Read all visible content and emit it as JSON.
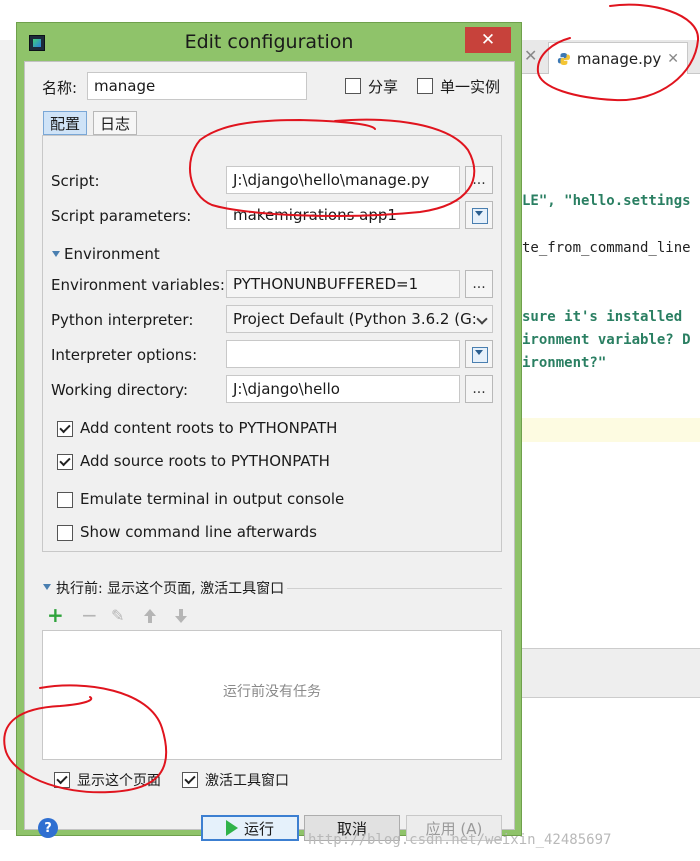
{
  "dialog": {
    "title": "Edit configuration",
    "close_glyph": "✕"
  },
  "header": {
    "name_label": "名称:",
    "name_value": "manage",
    "share_label": "分享",
    "single_instance_label": "单一实例"
  },
  "tabs": [
    {
      "label": "配置",
      "active": true
    },
    {
      "label": "日志",
      "active": false
    }
  ],
  "form": {
    "script_label": "Script:",
    "script_value": "J:\\django\\hello\\manage.py",
    "script_params_label": "Script parameters:",
    "script_params_value": "makemigrations app1",
    "environment_label": "Environment",
    "env_vars_label": "Environment variables:",
    "env_vars_value": "PYTHONUNBUFFERED=1",
    "python_interpreter_label": "Python interpreter:",
    "python_interpreter_value": "Project Default (Python 3.6.2 (G:",
    "interpreter_options_label": "Interpreter options:",
    "interpreter_options_value": "",
    "working_dir_label": "Working directory:",
    "working_dir_value": "J:\\django\\hello",
    "browse_glyph": "...",
    "checkboxes": [
      {
        "label": "Add content roots to PYTHONPATH",
        "checked": true
      },
      {
        "label": "Add source roots to PYTHONPATH",
        "checked": true
      },
      {
        "label": "Emulate terminal in output console",
        "checked": false
      },
      {
        "label": "Show command line afterwards",
        "checked": false
      }
    ]
  },
  "before_launch": {
    "title": "执行前: 显示这个页面, 激活工具窗口",
    "toolbar": {
      "add": "+",
      "remove": "−",
      "edit": "✎",
      "up": "🡅",
      "down": "🡇"
    },
    "empty_text": "运行前没有任务",
    "show_page_label": "显示这个页面",
    "show_page_checked": true,
    "activate_window_label": "激活工具窗口",
    "activate_window_checked": true
  },
  "buttons": {
    "help": "?",
    "run": "运行",
    "cancel": "取消",
    "apply": "应用 (A)"
  },
  "editor": {
    "tab_label": "manage.py",
    "tab_close": "✕",
    "prev_tab_close": "✕",
    "code_lines": [
      "LE\", \"hello.settings",
      "te_from_command_line",
      "sure it's installed",
      "ironment variable? D",
      "ironment?\""
    ]
  },
  "watermark": "http://blog.csdn.net/weixin_42485697",
  "colors": {
    "dialog_frame": "#8fc36a",
    "close_button": "#c7423b",
    "annotation_ink": "#e0141e",
    "code_green": "#2a7f62",
    "run_icon": "#2fb34a"
  }
}
